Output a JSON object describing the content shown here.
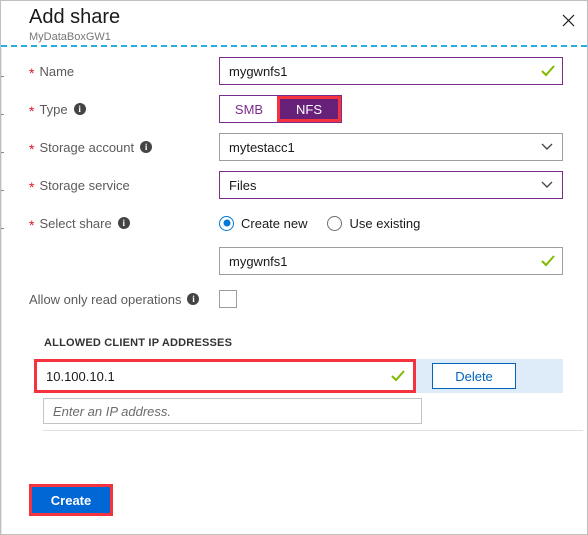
{
  "header": {
    "title": "Add share",
    "subtitle": "MyDataBoxGW1",
    "close_label": "Close"
  },
  "form": {
    "name": {
      "label": "Name",
      "required": true,
      "value": "mygwnfs1",
      "valid": true
    },
    "type": {
      "label": "Type",
      "required": true,
      "has_info": true,
      "options": [
        "SMB",
        "NFS"
      ],
      "selected": "NFS",
      "highlighted": true
    },
    "storage_account": {
      "label": "Storage account",
      "required": true,
      "has_info": true,
      "value": "mytestacc1"
    },
    "storage_service": {
      "label": "Storage service",
      "required": true,
      "has_info": false,
      "value": "Files"
    },
    "select_share": {
      "label": "Select share",
      "required": true,
      "has_info": true,
      "options": [
        "Create new",
        "Use existing"
      ],
      "selected": "Create new"
    },
    "share_name": {
      "value": "mygwnfs1",
      "valid": true
    },
    "read_only": {
      "label": "Allow only read operations",
      "has_info": true,
      "checked": false
    }
  },
  "allowed_ip": {
    "section_title": "ALLOWED CLIENT IP ADDRESSES",
    "rows": [
      {
        "value": "10.100.10.1",
        "valid": true,
        "highlighted": true,
        "delete_label": "Delete"
      }
    ],
    "new_row_placeholder": "Enter an IP address."
  },
  "footer": {
    "create_label": "Create",
    "create_highlighted": true
  },
  "colors": {
    "accent_purple": "#68217A",
    "accent_blue": "#0067D5",
    "highlight_red": "#F5333F",
    "valid_green": "#7FBA00",
    "required_red": "#E81123",
    "divider_cyan": "#27ADE4",
    "row_selected_blue": "#DEECF9"
  }
}
